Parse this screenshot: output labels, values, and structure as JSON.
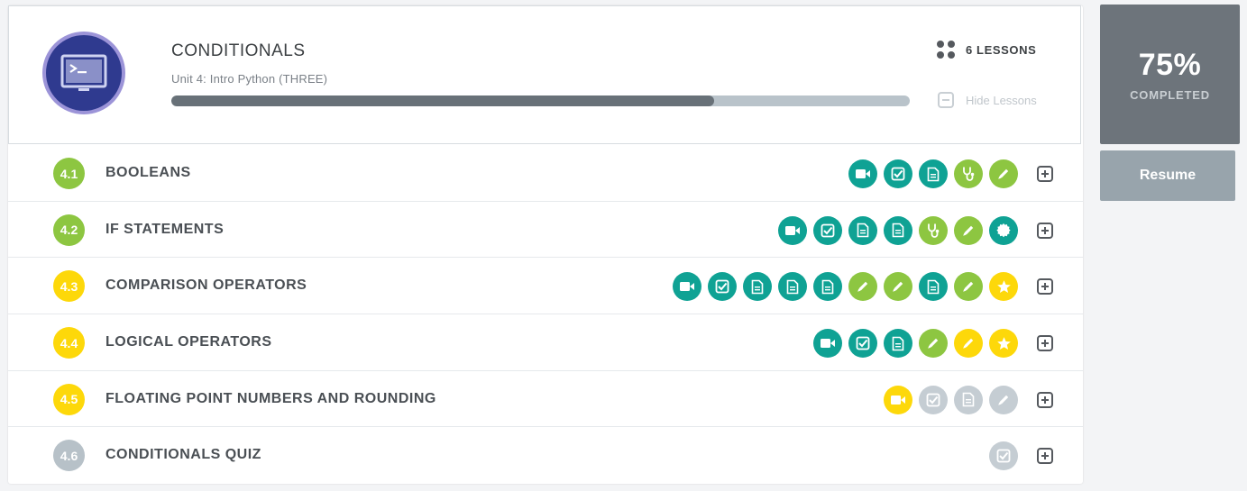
{
  "unit": {
    "title": "CONDITIONALS",
    "subtitle": "Unit 4: Intro Python (THREE)",
    "progress_fraction": 0.735,
    "lessons_count_label": "6 LESSONS",
    "hide_lessons_label": "Hide Lessons"
  },
  "completion": {
    "percent_label": "75%",
    "completed_label": "COMPLETED",
    "resume_label": "Resume"
  },
  "colors": {
    "teal": "#0fa294",
    "green": "#8dc641",
    "yellow": "#fdd80a",
    "gray": "#c5cdd3"
  },
  "lessons": [
    {
      "number": "4.1",
      "title": "BOOLEANS",
      "color": "#8dc641",
      "activities": [
        {
          "type": "video-icon",
          "color": "#0fa294"
        },
        {
          "type": "check-icon",
          "color": "#0fa294"
        },
        {
          "type": "document-icon",
          "color": "#0fa294"
        },
        {
          "type": "stethoscope-icon",
          "color": "#8dc641"
        },
        {
          "type": "pencil-icon",
          "color": "#8dc641"
        }
      ]
    },
    {
      "number": "4.2",
      "title": "IF STATEMENTS",
      "color": "#8dc641",
      "activities": [
        {
          "type": "video-icon",
          "color": "#0fa294"
        },
        {
          "type": "check-icon",
          "color": "#0fa294"
        },
        {
          "type": "document-icon",
          "color": "#0fa294"
        },
        {
          "type": "document-icon",
          "color": "#0fa294"
        },
        {
          "type": "stethoscope-icon",
          "color": "#8dc641"
        },
        {
          "type": "pencil-icon",
          "color": "#8dc641"
        },
        {
          "type": "badge-icon",
          "color": "#0fa294"
        }
      ]
    },
    {
      "number": "4.3",
      "title": "COMPARISON OPERATORS",
      "color": "#fdd80a",
      "activities": [
        {
          "type": "video-icon",
          "color": "#0fa294"
        },
        {
          "type": "check-icon",
          "color": "#0fa294"
        },
        {
          "type": "document-icon",
          "color": "#0fa294"
        },
        {
          "type": "document-icon",
          "color": "#0fa294"
        },
        {
          "type": "document-icon",
          "color": "#0fa294"
        },
        {
          "type": "pencil-icon",
          "color": "#8dc641"
        },
        {
          "type": "pencil-icon",
          "color": "#8dc641"
        },
        {
          "type": "document-icon",
          "color": "#0fa294"
        },
        {
          "type": "pencil-icon",
          "color": "#8dc641"
        },
        {
          "type": "star-icon",
          "color": "#fdd80a"
        }
      ]
    },
    {
      "number": "4.4",
      "title": "LOGICAL OPERATORS",
      "color": "#fdd80a",
      "activities": [
        {
          "type": "video-icon",
          "color": "#0fa294"
        },
        {
          "type": "check-icon",
          "color": "#0fa294"
        },
        {
          "type": "document-icon",
          "color": "#0fa294"
        },
        {
          "type": "pencil-icon",
          "color": "#8dc641"
        },
        {
          "type": "pencil-icon",
          "color": "#fdd80a"
        },
        {
          "type": "star-icon",
          "color": "#fdd80a"
        }
      ]
    },
    {
      "number": "4.5",
      "title": "FLOATING POINT NUMBERS AND ROUNDING",
      "color": "#fdd80a",
      "activities": [
        {
          "type": "video-icon",
          "color": "#fdd80a"
        },
        {
          "type": "check-icon",
          "color": "#c5cdd3"
        },
        {
          "type": "document-icon",
          "color": "#c5cdd3"
        },
        {
          "type": "pencil-icon",
          "color": "#c5cdd3"
        }
      ]
    },
    {
      "number": "4.6",
      "title": "CONDITIONALS QUIZ",
      "color": "#b7c1c8",
      "activities": [
        {
          "type": "check-icon",
          "color": "#c5cdd3"
        }
      ]
    }
  ]
}
